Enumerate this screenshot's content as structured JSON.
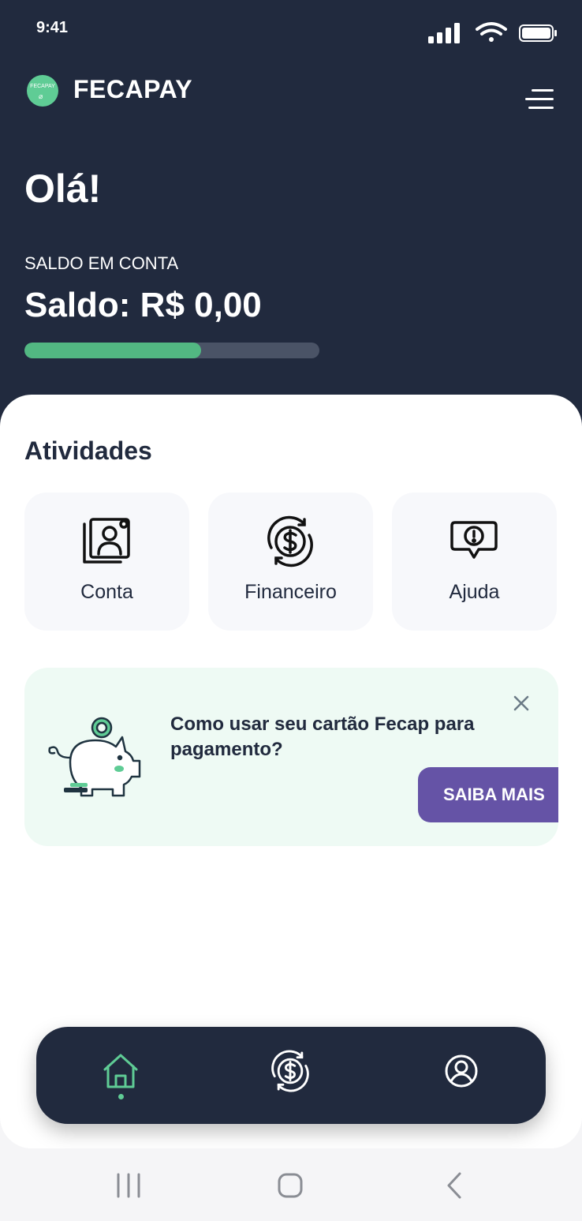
{
  "status_bar": {
    "time": "9:41"
  },
  "header": {
    "brand": "FECAPAY",
    "logo_text": "FECAPAY"
  },
  "greeting": "Olá!",
  "balance": {
    "label": "SALDO EM CONTA",
    "value": "Saldo: R$ 0,00",
    "progress_fraction": 0.6
  },
  "activities": {
    "title": "Atividades",
    "tiles": [
      {
        "label": "Conta",
        "icon": "account-icon"
      },
      {
        "label": "Financeiro",
        "icon": "dollar-exchange-icon"
      },
      {
        "label": "Ajuda",
        "icon": "help-chat-icon"
      }
    ]
  },
  "promo": {
    "text": "Como usar seu cartão Fecap para pagamento?",
    "button_label": "SAIBA MAIS"
  },
  "bottom_nav": {
    "items": [
      "home-icon",
      "dollar-exchange-icon",
      "profile-icon"
    ],
    "active": "home-icon"
  },
  "colors": {
    "primary_dark": "#212a3e",
    "accent_green": "#52b882",
    "button_purple": "#6553a6",
    "promo_bg": "#eefaf4"
  }
}
